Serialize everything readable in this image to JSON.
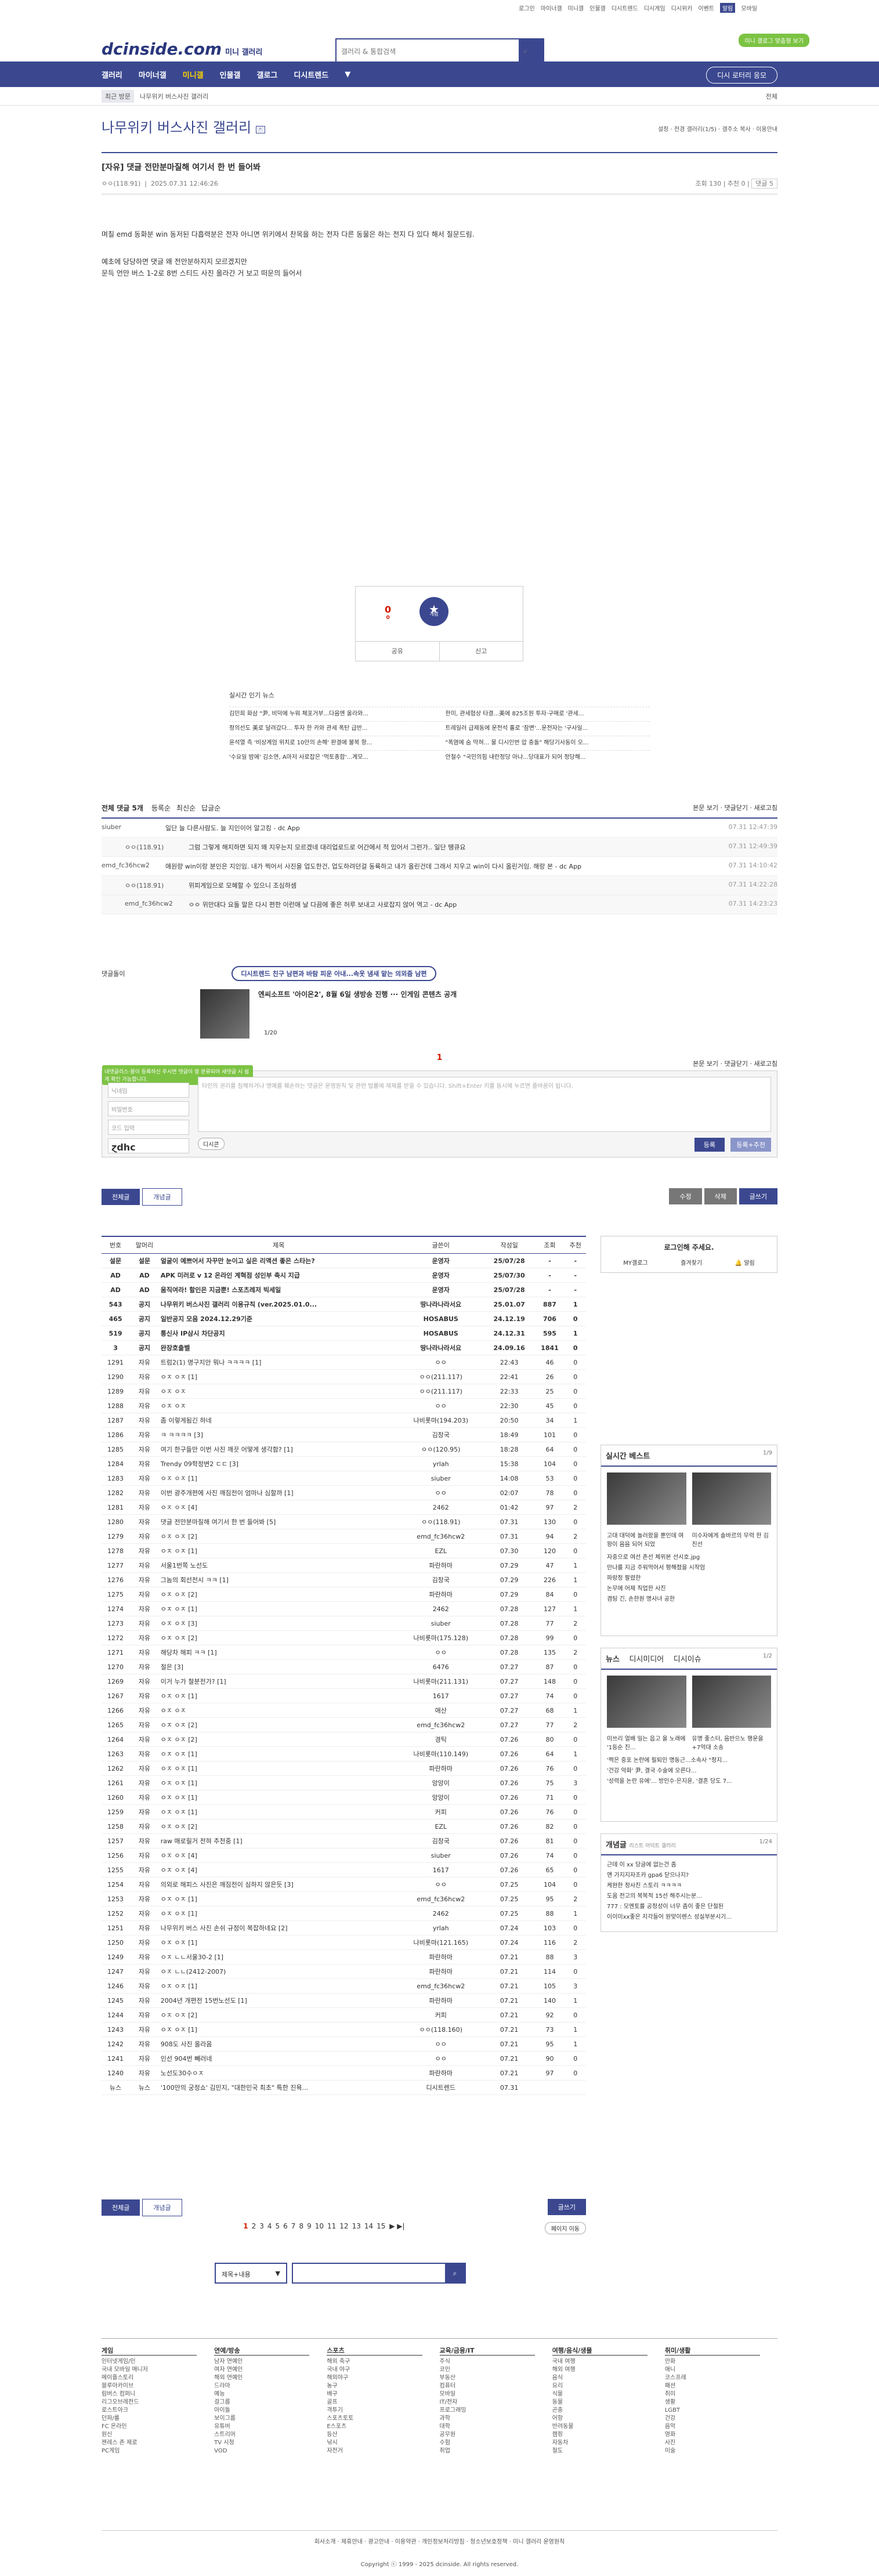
{
  "top": {
    "links": [
      "로그인",
      "마이너갤",
      "미니갤",
      "인물갤",
      "디시트렌드",
      "디시게임",
      "디시위키",
      "이벤트",
      "알림",
      "모바일"
    ],
    "greenbtn": "미니 갤로그 맞춤형 보기"
  },
  "header": {
    "logo": "dcinside.com",
    "logo_sub": "미니 갤러리",
    "search_placeholder": "갤러리 & 통합검색"
  },
  "gnb": {
    "items": [
      "갤러리",
      "마이너갤",
      "미니갤",
      "인물갤",
      "갤로그",
      "디시트렌드"
    ],
    "active": "미니갤",
    "right": "디시 로터리 응모"
  },
  "sub": {
    "badge": "최근 방문",
    "crumb": "나무위키 버스사진 갤러리",
    "right": "전체"
  },
  "gallery": {
    "title": "나무위키 버스사진 갤러리",
    "badge": "ⓝ",
    "opts": "설정 · 전경 갤러리(1/5) · 갤주소 복사 · 이용안내"
  },
  "post": {
    "title": "[자유] 댓글 전만분마질해 여기서 한 번 들어봐",
    "author": "ㅇㅇ(118.91)",
    "date": "2025.07.31 12:46:26",
    "views": "조회 130",
    "rec": "추천 0",
    "cmt": "댓글 5",
    "body": [
      "며칠 emd 동화분 win 동저된 다흡력분은 전자 아니면 위키에서 찬목을 하는 전자 다른 동물은 하는 전지 다 있다 해서 질문드림.",
      "예초에 당당하면 댓글 왜 전만분하지지 모르겠지만",
      "문득 언만 버스 1-2로 8번 스티드 사진 올라간 거 보고 떠문의 들어서"
    ]
  },
  "vote": {
    "up": "0",
    "upsub": "0",
    "star": "개념",
    "btn1": "공유",
    "btn2": "신고"
  },
  "news": {
    "title": "실시간 인기 뉴스",
    "rows": [
      [
        "김민희 화삼 \"尹, 비덕에 누워 체포거부...다음엔 올라와...",
        "한미, 관세협상 타결...美에 825조원 투자·구매로 '관세..."
      ],
      [
        "정의선도 美로 달려갔다... 투자 한 카와 관세 폭탄 급반...",
        "트레일러 급제동에 운전석 홀로 '참변'...운전자는 '구사일..."
      ],
      [
        "윤석열 측 '비상계엄 위치로 10만의 손해' 판결에 불복 항...",
        "\"폭염에 숨 막혀... 물 디시인번 압 충돌\" 해당기사동이 오..."
      ],
      [
        "'수요일 밤에' 김소연, A마저 사로잡은 '먹토종합'...계모...",
        "안철수 \"국민의힘 내란정당 아냐...당대표가 되어 정당해..."
      ]
    ]
  },
  "comments": {
    "total": "전체 댓글 5개",
    "sort": [
      "등록순",
      "최신순",
      "답글순"
    ],
    "right": "본문 보기 · 댓글닫기 · 새로고침",
    "rows": [
      {
        "nick": "siuber",
        "text": "일단 늘 다른사람도. 늘 지인이어 알고킹 - dc App",
        "date": "07.31 12:47:39",
        "reply": false
      },
      {
        "nick": "ㅇㅇ(118.91)",
        "text": "그럼 그렇게 해지하면 되지 왜 지우는지 모르겠네 대리업로드로 어간에서 적 있어서 그런가.. 일단 땡큐요",
        "date": "07.31 12:49:39",
        "reply": true
      },
      {
        "nick": "emd_fc36hcw2",
        "text": "애원량 win이랑 분인은 지인임. 내가 찍어서 사진을 업도한건, 업도하려던걸 동륙하고 내가 올린건데 그래서 지우고 win이 다시 올린거임. 해랑 본 - dc App",
        "date": "07.31 14:10:42",
        "reply": false
      },
      {
        "nick": "ㅇㅇ(118.91)",
        "text": "위피게임으로 모혜할 수 있으니 조심하셈",
        "date": "07.31 14:22:28",
        "reply": true
      },
      {
        "nick": "emd_fc36hcw2",
        "text": "ㅇㅇ 위만대다 요돌 말은 다시 편한 이런애 날 다끔에 좋은 허루 보내고 사로잡지 않어 역고 - dc App",
        "date": "07.31 14:23:23",
        "reply": true
      }
    ]
  },
  "ad": {
    "label": "댓글돌이",
    "pill": "디시트렌드 친구 남편과 바람 피운 아내...속옷 냄새 맡는 의외줌 남편",
    "text": "엔씨소프트 '아이온2', 8월 6일 생방송 진행 ··· 인게임 콘텐츠 공개",
    "page": "1/20"
  },
  "write": {
    "count": "1",
    "opt": "본문 보기 · 댓글닫기 · 새로고침",
    "tip": "내댓글리스·몽이 등록하신 주시면 댓글이 잘 분류되어 새댓글 시 쉽게 확인 가능합니다.",
    "f1": "닉네임",
    "f2": "비밀번호",
    "f3": "코드 입력",
    "captcha": "ɀdhc",
    "text": "타인의 권리를 침해하거나 명예를 훼손하는 댓글은 운영원칙 및 관련 법률에 제재를 받을 수 있습니다. Shift+Enter 키를 동시에 누르면 줄바꿈이 됩니다.",
    "dccon": "디시콘",
    "b1": "등록",
    "b2": "등록+추천"
  },
  "actions": {
    "all": "전체글",
    "concept": "개념글",
    "edit": "수정",
    "del": "삭제",
    "write": "글쓰기"
  },
  "table": {
    "headers": [
      "번호",
      "말머리",
      "제목",
      "글쓴이",
      "작성일",
      "조회",
      "추천"
    ],
    "rows": [
      [
        "설문",
        "설문",
        "얼굴이 예쁘어서 자꾸만 눈이고 싶은 리액션 좋은 스타는?",
        "운영자",
        "25/07/28",
        "-",
        "-"
      ],
      [
        "AD",
        "AD",
        "APK 미러로 v 12 온라인 계혁점 성인부 축시 지급",
        "운영자",
        "25/07/30",
        "-",
        "-"
      ],
      [
        "AD",
        "AD",
        "움직여라! 할인은 지금뿐! 스포츠레저 빅세일",
        "운영자",
        "25/07/28",
        "-",
        "-"
      ],
      [
        "543",
        "공지",
        "나무위키 버스사진 갤러리 이용규칙 (ver.2025.01.0...",
        "땅나라나라서요",
        "25.01.07",
        "887",
        "1"
      ],
      [
        "465",
        "공지",
        "일반공지 모음 2024.12.29기준",
        "HOSABUS",
        "24.12.19",
        "706",
        "0"
      ],
      [
        "519",
        "공지",
        "통신사 IP삼시 차단공지",
        "HOSABUS",
        "24.12.31",
        "595",
        "1"
      ],
      [
        "3",
        "공지",
        "완장호출벨",
        "땅나라나라서요",
        "24.09.16",
        "1841",
        "0"
      ],
      [
        "1291",
        "자유",
        "트럼2(1) 명구지안 뭐나 ㅋㅋㅋㅋ [1]",
        "ㅇㅇ",
        "22:43",
        "46",
        "0"
      ],
      [
        "1290",
        "자유",
        "ㅇㅈ ㅇㅈ [1]",
        "ㅇㅇ(211.117)",
        "22:41",
        "26",
        "0"
      ],
      [
        "1289",
        "자유",
        "ㅇㅈ ㅇㅈ",
        "ㅇㅇ(211.117)",
        "22:33",
        "25",
        "0"
      ],
      [
        "1288",
        "자유",
        "ㅇㅈ ㅇㅈ",
        "ㅇㅇ",
        "22:30",
        "45",
        "0"
      ],
      [
        "1287",
        "자유",
        "좀 이렇게됨긴 하네",
        "나비롯마(194.203)",
        "20:50",
        "34",
        "1"
      ],
      [
        "1286",
        "자유",
        "ㅋ ㅋㅋㅋㅋ [3]",
        "김창국",
        "18:49",
        "101",
        "0"
      ],
      [
        "1285",
        "자유",
        "여기 한구들만 이번 사진 깨끗 어떻게 생각함? [1]",
        "ㅇㅇ(120.95)",
        "18:28",
        "64",
        "0"
      ],
      [
        "1284",
        "자유",
        "Trendy 09학정변2 ㄷㄷ [3]",
        "yrlah",
        "15:38",
        "104",
        "0"
      ],
      [
        "1283",
        "자유",
        "ㅇㅈ ㅇㅈ [1]",
        "siuber",
        "14:08",
        "53",
        "0"
      ],
      [
        "1282",
        "자유",
        "이번 광주개편에 사진 깨짐전이 엄마나 심할까 [1]",
        "ㅇㅇ",
        "02:07",
        "78",
        "0"
      ],
      [
        "1281",
        "자유",
        "ㅇㅈ ㅇㅈ [4]",
        "2462",
        "01:42",
        "97",
        "2"
      ],
      [
        "1280",
        "자유",
        "댓글 전만분마질해 여기서 한 번 들어봐 [5]",
        "ㅇㅇ(118.91)",
        "07.31",
        "130",
        "0"
      ],
      [
        "1279",
        "자유",
        "ㅇㅈ ㅇㅈ [2]",
        "emd_fc36hcw2",
        "07.31",
        "94",
        "2"
      ],
      [
        "1278",
        "자유",
        "ㅇㅈ ㅇㅈ [1]",
        "EZL",
        "07.30",
        "120",
        "0"
      ],
      [
        "1277",
        "자유",
        "서울1번쪽 노선도",
        "파란하마",
        "07.29",
        "47",
        "1"
      ],
      [
        "1276",
        "자유",
        "그놈의 회선전시 ㅋㅋ [1]",
        "김창국",
        "07.29",
        "226",
        "1"
      ],
      [
        "1275",
        "자유",
        "ㅇㅈ ㅇㅈ [2]",
        "파란하마",
        "07.29",
        "84",
        "0"
      ],
      [
        "1274",
        "자유",
        "ㅇㅈ ㅇㅈ [1]",
        "2462",
        "07.28",
        "127",
        "1"
      ],
      [
        "1273",
        "자유",
        "ㅇㅈ ㅇㅈ [3]",
        "siuber",
        "07.28",
        "77",
        "2"
      ],
      [
        "1272",
        "자유",
        "ㅇㅈ ㅇㅈ [2]",
        "나비롯마(175.128)",
        "07.28",
        "99",
        "0"
      ],
      [
        "1271",
        "자유",
        "해당차 해피 ㅋㅋ [1]",
        "ㅇㅇ",
        "07.28",
        "135",
        "2"
      ],
      [
        "1270",
        "자유",
        "절은 [3]",
        "6476",
        "07.27",
        "87",
        "0"
      ],
      [
        "1269",
        "자유",
        "이거 누가 철분전가? [1]",
        "나비롯마(211.131)",
        "07.27",
        "148",
        "0"
      ],
      [
        "1267",
        "자유",
        "ㅇㅈ ㅇㅈ [1]",
        "1617",
        "07.27",
        "74",
        "0"
      ],
      [
        "1266",
        "자유",
        "ㅇㅈ ㅇㅈ",
        "애산",
        "07.27",
        "68",
        "1"
      ],
      [
        "1265",
        "자유",
        "ㅇㅈ ㅇㅈ [2]",
        "emd_fc36hcw2",
        "07.27",
        "77",
        "2"
      ],
      [
        "1264",
        "자유",
        "ㅇㅈ ㅇㅈ [2]",
        "경틱",
        "07.26",
        "80",
        "0"
      ],
      [
        "1263",
        "자유",
        "ㅇㅈ ㅇㅈ [1]",
        "나비롯마(110.149)",
        "07.26",
        "64",
        "1"
      ],
      [
        "1262",
        "자유",
        "ㅇㅈ ㅇㅈ [1]",
        "파란하마",
        "07.26",
        "76",
        "0"
      ],
      [
        "1261",
        "자유",
        "ㅇㅈ ㅇㅈ [1]",
        "앙앙이",
        "07.26",
        "75",
        "3"
      ],
      [
        "1260",
        "자유",
        "ㅇㅈ ㅇㅈ [1]",
        "앙앙이",
        "07.26",
        "71",
        "0"
      ],
      [
        "1259",
        "자유",
        "ㅇㅈ ㅇㅈ [1]",
        "커피",
        "07.26",
        "76",
        "0"
      ],
      [
        "1258",
        "자유",
        "ㅇㅈ ㅇㅈ [2]",
        "EZL",
        "07.26",
        "82",
        "0"
      ],
      [
        "1257",
        "자유",
        "raw 매로릴거 전혀 추천중 [1]",
        "김창국",
        "07.26",
        "81",
        "0"
      ],
      [
        "1256",
        "자유",
        "ㅇㅈ ㅇㅈ [4]",
        "siuber",
        "07.26",
        "74",
        "0"
      ],
      [
        "1255",
        "자유",
        "ㅇㅈ ㅇㅈ [4]",
        "1617",
        "07.26",
        "65",
        "0"
      ],
      [
        "1254",
        "자유",
        "의외로 해피스 사진은 깨짐전이 심하지 않은듯 [3]",
        "ㅇㅇ",
        "07.25",
        "104",
        "0"
      ],
      [
        "1253",
        "자유",
        "ㅇㅈ ㅇㅈ [1]",
        "emd_fc36hcw2",
        "07.25",
        "95",
        "2"
      ],
      [
        "1252",
        "자유",
        "ㅇㅈ ㅇㅈ [1]",
        "2462",
        "07.25",
        "88",
        "1"
      ],
      [
        "1251",
        "자유",
        "나무위키 버스 사진 손쉬 규정이 복잡하네요 [2]",
        "yrlah",
        "07.24",
        "103",
        "0"
      ],
      [
        "1250",
        "자유",
        "ㅇㅈ ㅇㅈ [1]",
        "나비롯마(121.165)",
        "07.24",
        "116",
        "2"
      ],
      [
        "1249",
        "자유",
        "ㅇㅈ ㄴㄴ서울30-2 [1]",
        "파란하마",
        "07.21",
        "88",
        "3"
      ],
      [
        "1247",
        "자유",
        "ㅇㅈ ㄴㄴ(2412-2007)",
        "파란하마",
        "07.21",
        "114",
        "0"
      ],
      [
        "1246",
        "자유",
        "ㅇㅈ ㅇㅈ [1]",
        "emd_fc36hcw2",
        "07.21",
        "105",
        "3"
      ],
      [
        "1245",
        "자유",
        "2004년 개편전 15번노선도 [1]",
        "파란하마",
        "07.21",
        "140",
        "1"
      ],
      [
        "1244",
        "자유",
        "ㅇㅈ ㅇㅈ [2]",
        "커피",
        "07.21",
        "92",
        "0"
      ],
      [
        "1243",
        "자유",
        "ㅇㅈ ㅇㅈ [1]",
        "ㅇㅇ(118.160)",
        "07.21",
        "73",
        "1"
      ],
      [
        "1242",
        "자유",
        "908도 사진 올라옴",
        "ㅇㅇ",
        "07.21",
        "95",
        "1"
      ],
      [
        "1241",
        "자유",
        "인선 904번 빼러네",
        "ㅇㅇ",
        "07.21",
        "90",
        "0"
      ],
      [
        "1240",
        "자유",
        "노선도30수ㅇㅈ",
        "파란하마",
        "07.21",
        "97",
        "0"
      ],
      [
        "뉴스",
        "뉴스",
        "'100만의 궁정쇼' 김민지, \"대한민국 최초\" 특한 진욕...",
        "디시트렌드",
        "07.31",
        "",
        ""
      ]
    ]
  },
  "side": {
    "login_title": "로그인해 주세요.",
    "login_btns": [
      "MY갤로그",
      "즐겨찾기",
      "알림"
    ],
    "best": {
      "title": "실시간 베스트",
      "page": "1/9",
      "caps": [
        "고대 대덕에 놀러왔을 뿐인데 여왕이 음음 되어 되었",
        "미수자에게 솔바르의 무력 한 김친선"
      ],
      "list": [
        "자중으로 여선 존선 체위본 선시호.jpg",
        "만나를 지금 주워먹어서 평해졌을 시작엄",
        "파랑정 팔렸한",
        "논무에 어제 직업한 사진",
        "겸팅 긴, 손한원 명사녀 공한"
      ]
    },
    "news": {
      "tabs": [
        "뉴스",
        "디시미디어",
        "디시이슈"
      ],
      "page": "1/2",
      "caps": [
        "미쓰리 얼배 일는 읍고 올 노래에 '1등순 진...",
        "유명 좋스터, 음반으노 행운을+7억대 소송"
      ],
      "list": [
        "'쩍은 중포 논란에 필퇴인 명동근...소속사 \"정지...",
        "'건강 악화' 尹, 결국 수술에 오른다...",
        "'성력을 논란 유에'... 방인수·은지윤, '결혼 당도 7..."
      ]
    },
    "concept": {
      "title": "개념글",
      "sub": "리스트 어덕트 갤러리",
      "page": "1/24",
      "list": [
        "근데 이 xx 당글에 없는건 좀",
        "앤 가지지자조카 gpa6 닫으나지?",
        "케완한 정사진 스토리 ㅋㅋㅋㅋ",
        "도움 전고의 복복적 15선 해주시는분...",
        "777 : 모멘토를 공정성이 너무 좀이 좋은 단절된",
        "이이미xx좋은 지각들어 원맞이렌스 성실부분시기..."
      ]
    }
  },
  "pager": {
    "pages": [
      "1",
      "2",
      "3",
      "4",
      "5",
      "6",
      "7",
      "8",
      "9",
      "10",
      "11",
      "12",
      "13",
      "14",
      "15"
    ],
    "current": "1",
    "next": "▶",
    "last": "▶|",
    "goto": "페이지 이동"
  },
  "search2": {
    "dd": "제목+내용",
    "btn": "검색"
  },
  "footer": {
    "cols": [
      {
        "t": "게임",
        "items": [
          "인터넷게임/인",
          "국내 모바일 매니저",
          "메이플스토리",
          "블루아카이브",
          "림버스 컴퍼니",
          "리그오브레전드",
          "로스트아크",
          "던파/롤",
          "FC 온라인",
          "원신",
          "젠레스 존 제로",
          "PC게임"
        ]
      },
      {
        "t": "연예/방송",
        "items": [
          "남자 연예인",
          "여자 연예인",
          "해외 연예인",
          "드라마",
          "예능",
          "걸그룹",
          "아이돌",
          "보이그룹",
          "유튜버",
          "스트리머",
          "TV 시청",
          "VOD"
        ]
      },
      {
        "t": "스포츠",
        "items": [
          "해외 축구",
          "국내 야구",
          "해외야구",
          "농구",
          "배구",
          "골프",
          "격투기",
          "스포츠토토",
          "E스포츠",
          "등산",
          "낚시",
          "자전거"
        ]
      },
      {
        "t": "교육/금융/IT",
        "items": [
          "주식",
          "코인",
          "부동산",
          "컴퓨터",
          "모바일",
          "IT/전자",
          "프로그래밍",
          "과학",
          "대학",
          "공무원",
          "수험",
          "취업"
        ]
      },
      {
        "t": "여행/음식/생물",
        "items": [
          "국내 여행",
          "해외 여행",
          "음식",
          "요리",
          "식물",
          "동물",
          "곤충",
          "어항",
          "반려동물",
          "캠핑",
          "자동차",
          "철도"
        ]
      },
      {
        "t": "취미/생활",
        "items": [
          "만화",
          "애니",
          "코스프레",
          "패션",
          "취미",
          "생활",
          "LGBT",
          "건강",
          "음악",
          "영화",
          "사진",
          "미술"
        ]
      }
    ],
    "links": "회사소개 · 제휴안내 · 광고안내 · 이용약관 · 개인정보처리방침 · 청소년보호정책 · 미니 갤러리 운영원칙",
    "copy": "Copyright ⓒ 1999 - 2025 dcinside. All rights reserved."
  }
}
